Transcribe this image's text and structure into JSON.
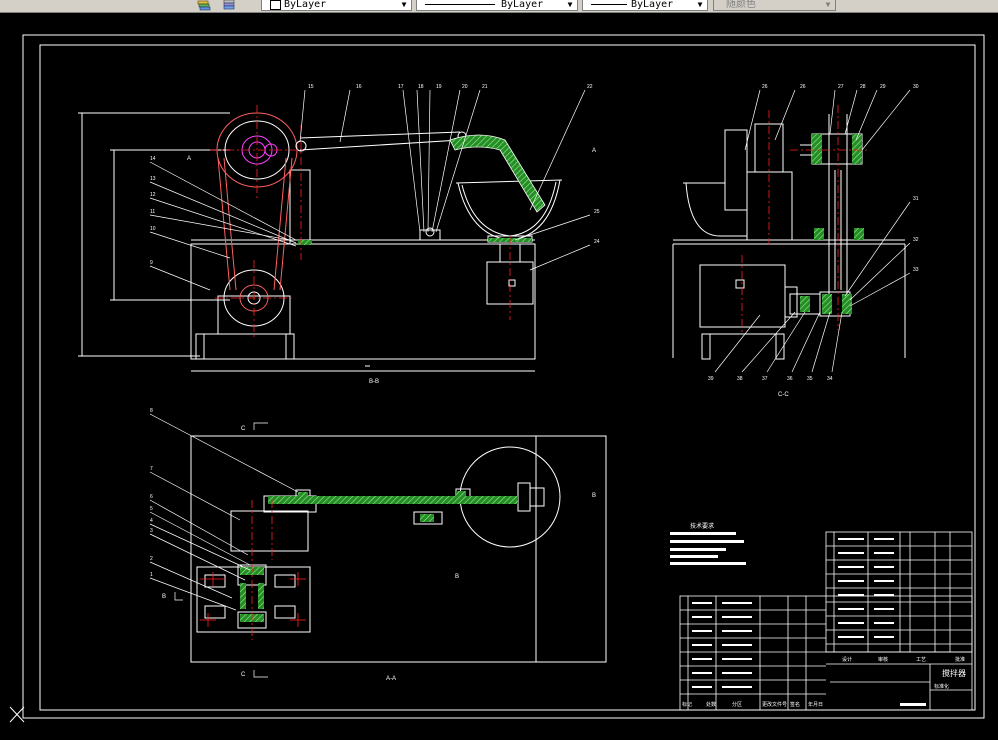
{
  "toolbar": {
    "layer_color_value": "ByLayer",
    "linetype_value": "ByLayer",
    "lineweight_value": "ByLayer",
    "plotstyle_value": "随颜色",
    "icons": [
      "layer-properties-icon",
      "layer-states-icon"
    ]
  },
  "colors": {
    "background": "#000000",
    "lines": "#ffffff",
    "centerline": "#ff2020",
    "section_fill": "#3cb43c",
    "accent": "#ff40ff"
  },
  "drawing": {
    "section_bb": "B-B",
    "section_cc": "C-C",
    "section_aa": "A-A",
    "view_marks": {
      "a_top": "A",
      "a_right": "A",
      "c_top": "C",
      "c_bottom": "C",
      "b_left": "B",
      "b_center": "B",
      "b_right": "B"
    },
    "callouts_bb": [
      "15",
      "16",
      "17",
      "18",
      "19",
      "20",
      "21",
      "22",
      "14",
      "13",
      "12",
      "11",
      "10",
      "9",
      "25",
      "24"
    ],
    "callouts_cc_top": [
      "26",
      "26",
      "27",
      "28",
      "29",
      "30"
    ],
    "callouts_cc_right": [
      "31",
      "32",
      "33"
    ],
    "callouts_cc_bottom": [
      "39",
      "38",
      "37",
      "36",
      "35",
      "34"
    ],
    "callouts_aa": [
      "8",
      "7",
      "6",
      "5",
      "4",
      "3",
      "2",
      "1"
    ],
    "tech_req_title": "技术要求",
    "title_block": {
      "drawing_name": "搅拌器",
      "company": "",
      "row_labels": [
        "标记",
        "处数",
        "分区",
        "更改文件号",
        "签名",
        "年月日"
      ],
      "cells": [
        "设计",
        "审核",
        "工艺",
        "批准",
        "标准化",
        "阶段标记",
        "重量",
        "比例"
      ]
    }
  }
}
